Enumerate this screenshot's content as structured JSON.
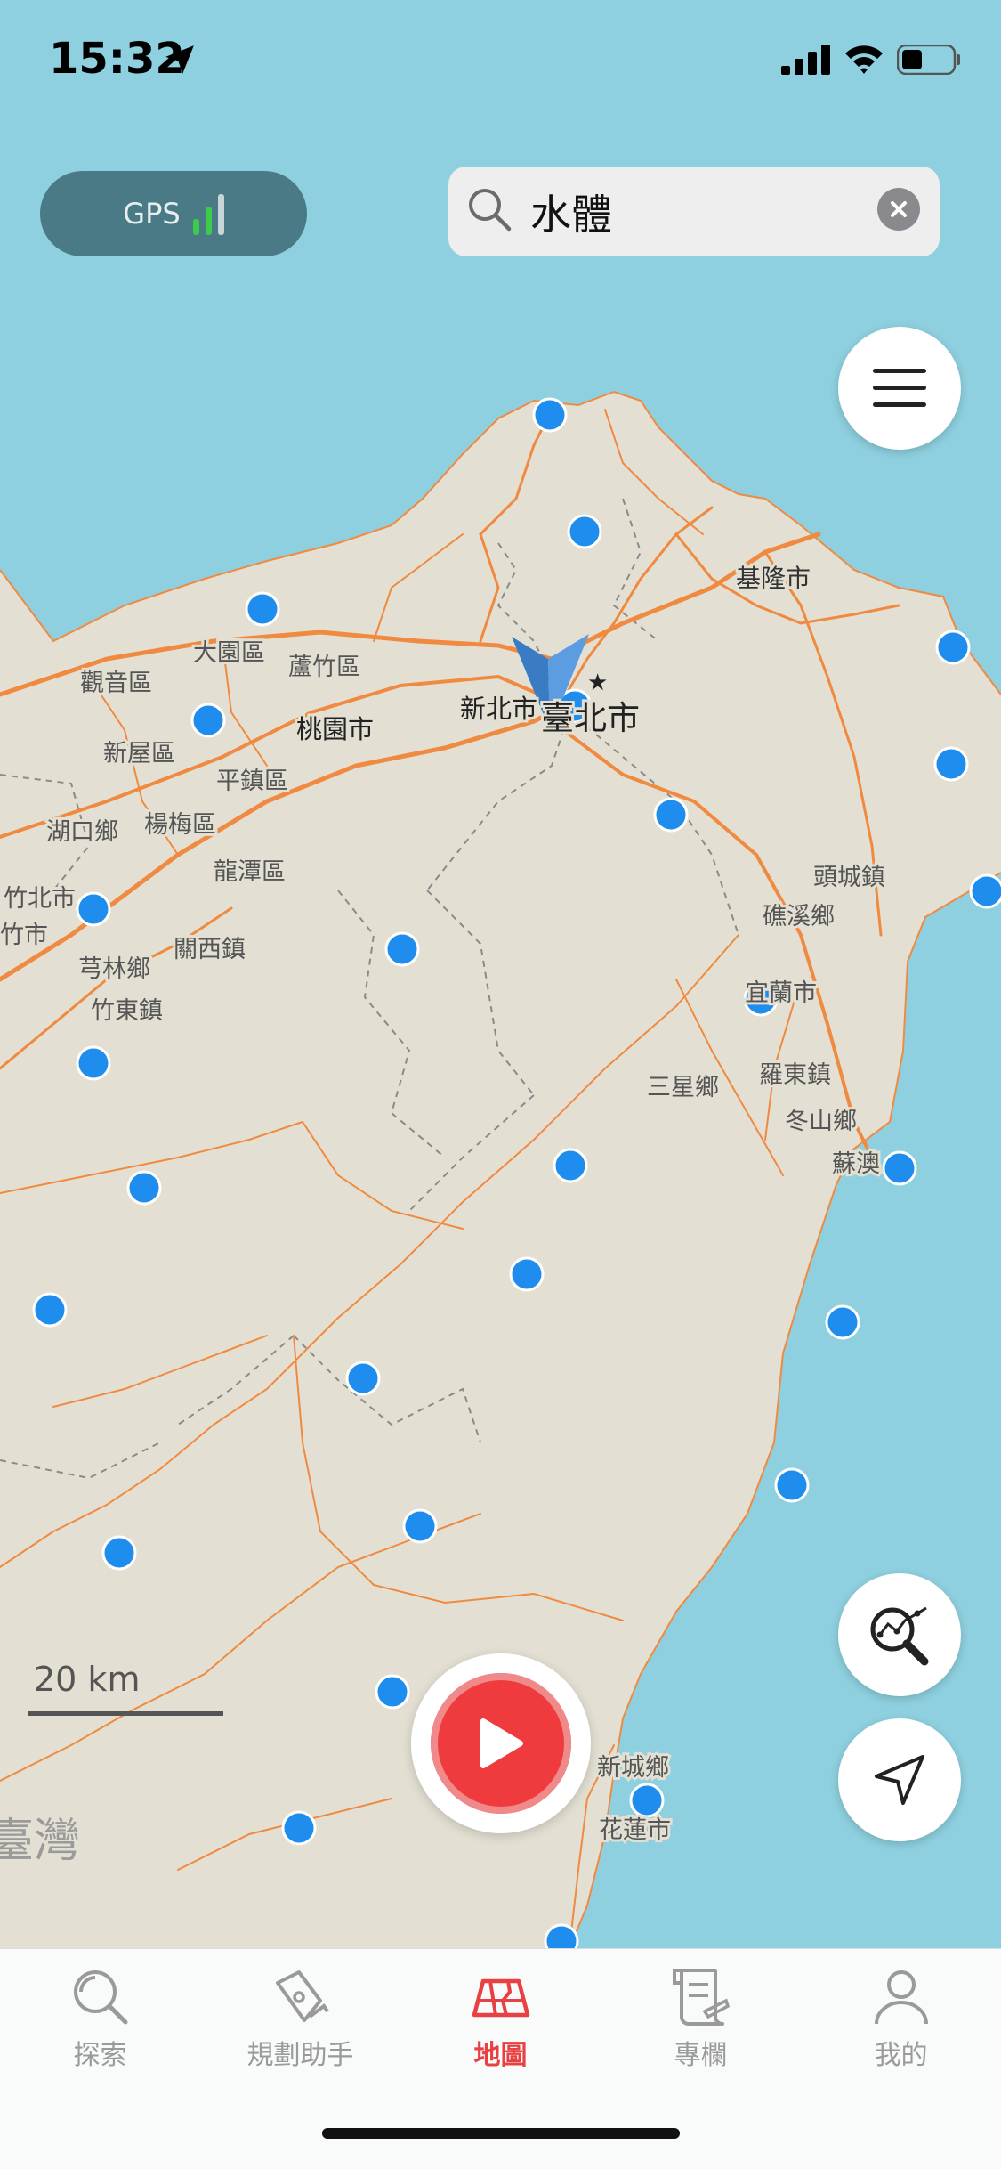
{
  "status_bar": {
    "time": "15:32",
    "icons": [
      "location-arrow-icon",
      "signal-icon",
      "wifi-icon",
      "battery-icon"
    ]
  },
  "gps": {
    "label": "GPS",
    "signal_bars_active": 2,
    "signal_bars_total": 3,
    "active_color": "#3ccb4a"
  },
  "search": {
    "value": "水體",
    "placeholder": ""
  },
  "map": {
    "place_labels": [
      {
        "name": "基隆市",
        "size": "medium"
      },
      {
        "name": "大園區",
        "size": "small"
      },
      {
        "name": "蘆竹區",
        "size": "small"
      },
      {
        "name": "觀音區",
        "size": "small"
      },
      {
        "name": "桃園市",
        "size": "medium"
      },
      {
        "name": "新北市",
        "size": "medium"
      },
      {
        "name": "臺北市",
        "size": "large"
      },
      {
        "name": "新屋區",
        "size": "small"
      },
      {
        "name": "平鎮區",
        "size": "small"
      },
      {
        "name": "湖口鄉",
        "size": "small"
      },
      {
        "name": "楊梅區",
        "size": "small"
      },
      {
        "name": "頭城鎮",
        "size": "small"
      },
      {
        "name": "龍潭區",
        "size": "small"
      },
      {
        "name": "竹北市",
        "size": "small"
      },
      {
        "name": "礁溪鄉",
        "size": "small"
      },
      {
        "name": "竹市",
        "size": "small"
      },
      {
        "name": "關西鎮",
        "size": "small"
      },
      {
        "name": "芎林鄉",
        "size": "small"
      },
      {
        "name": "宜蘭市",
        "size": "small"
      },
      {
        "name": "竹東鎮",
        "size": "small"
      },
      {
        "name": "羅東鎮",
        "size": "small"
      },
      {
        "name": "三星鄉",
        "size": "small"
      },
      {
        "name": "冬山鄉",
        "size": "small"
      },
      {
        "name": "蘇澳",
        "size": "small"
      },
      {
        "name": "新城鄉",
        "size": "small"
      },
      {
        "name": "花蓮市",
        "size": "small"
      },
      {
        "name": "臺灣",
        "size": "region"
      }
    ],
    "poi_color": "#1f8ded",
    "road_color": "#f08a40",
    "land_color": "#e3e0d3",
    "water_color": "#8ed0df"
  },
  "scale": {
    "label": "20 km"
  },
  "tabs": [
    {
      "label": "探索",
      "icon": "explore-search-icon",
      "active": false
    },
    {
      "label": "規劃助手",
      "icon": "pen-plan-icon",
      "active": false
    },
    {
      "label": "地圖",
      "icon": "map-icon",
      "active": true
    },
    {
      "label": "專欄",
      "icon": "article-scroll-icon",
      "active": false
    },
    {
      "label": "我的",
      "icon": "profile-icon",
      "active": false
    }
  ]
}
